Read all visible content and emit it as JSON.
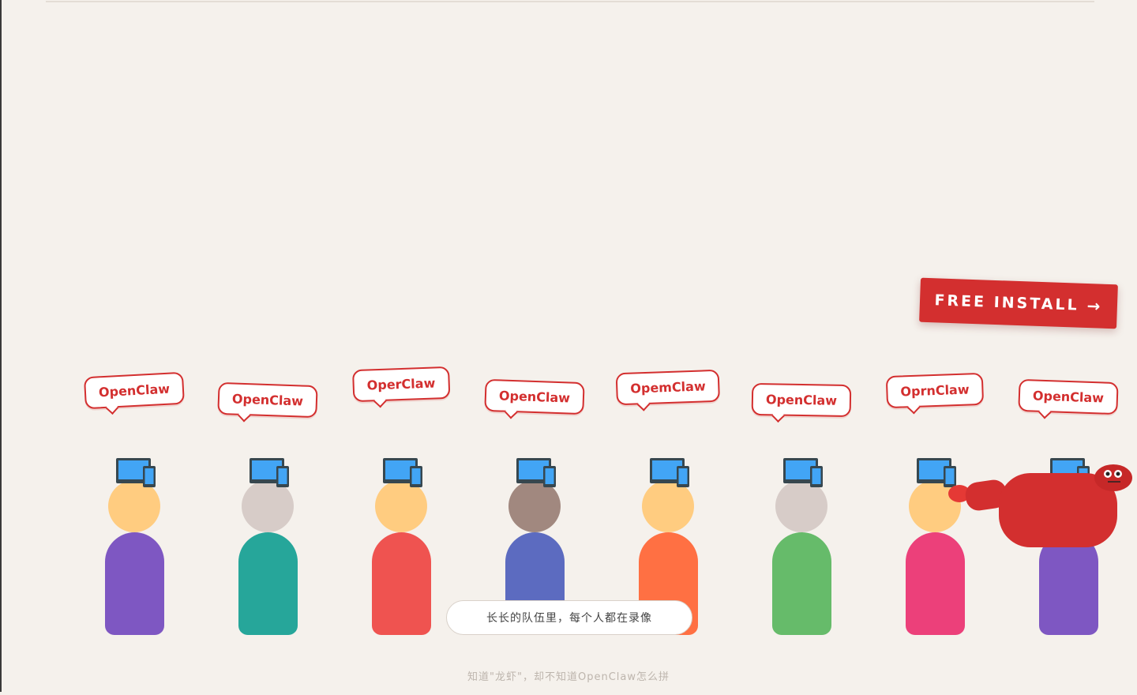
{
  "install_button": {
    "label": "FREE INSTALL",
    "arrow": "→",
    "color": "#d32f2f"
  },
  "queue": {
    "people": [
      {
        "bubble": "OpenClaw",
        "head_color": "#ffcc80",
        "body_color": "#7e57c2",
        "tilt": -3
      },
      {
        "bubble": "OpenClaw",
        "head_color": "#d7ccc8",
        "body_color": "#26a69a",
        "tilt": 2
      },
      {
        "bubble": "OperClaw",
        "head_color": "#ffcc80",
        "body_color": "#ef5350",
        "tilt": -2
      },
      {
        "bubble": "OpenClaw",
        "head_color": "#a1887f",
        "body_color": "#5c6bc0",
        "tilt": 2
      },
      {
        "bubble": "OpemClaw",
        "head_color": "#ffcc80",
        "body_color": "#ff7043",
        "tilt": -2
      },
      {
        "bubble": "OpenClaw",
        "head_color": "#d7ccc8",
        "body_color": "#66bb6a",
        "tilt": 1
      },
      {
        "bubble": "OprnClaw",
        "head_color": "#ffcc80",
        "body_color": "#ec407a",
        "tilt": -2
      },
      {
        "bubble": "OpenClaw",
        "head_color": "#d7ccc8",
        "body_color": "#7e57c2",
        "tilt": 2
      }
    ]
  },
  "icons": {
    "device": "laptop-phone-icon",
    "mascot": "lobster-mascot"
  },
  "caption": "长长的队伍里，每个人都在录像",
  "footer": "知道\"龙虾\"，却不知道OpenClaw怎么拼",
  "colors": {
    "background": "#f5f1ec",
    "accent": "#d32f2f",
    "device_screen": "#42a5f5",
    "device_frame": "#37474f"
  }
}
